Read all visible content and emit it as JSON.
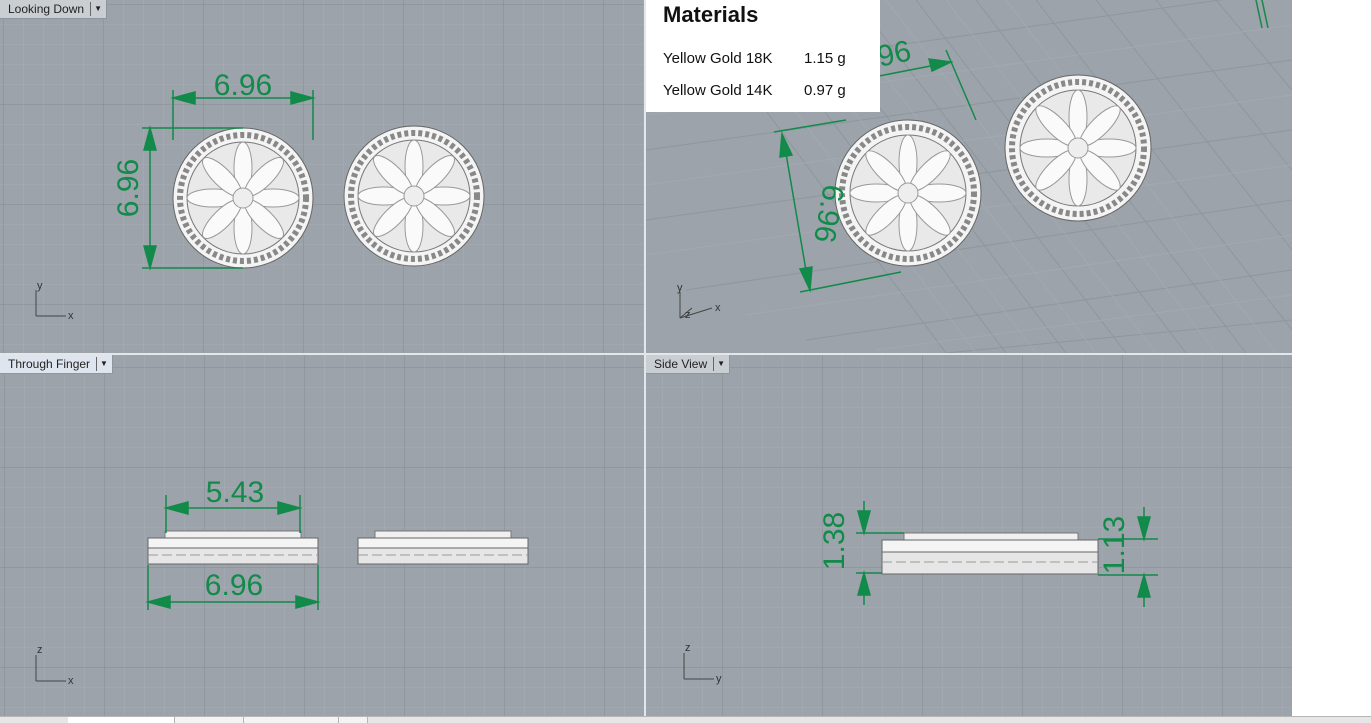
{
  "viewports": {
    "top": {
      "label": "Looking Down",
      "axis_v": "y",
      "axis_h": "x"
    },
    "perspective": {
      "axis_v": "y",
      "axis_h": "x",
      "axis_d": "z"
    },
    "front": {
      "label": "Through Finger",
      "axis_v": "z",
      "axis_h": "x"
    },
    "side": {
      "label": "Side View",
      "axis_v": "z",
      "axis_h": "y"
    }
  },
  "dimensions": {
    "top_width": "6.96",
    "top_height": "6.96",
    "persp_width": "6.96",
    "persp_height": "6.96",
    "front_top_width": "5.43",
    "front_bottom_width": "6.96",
    "side_height_left": "1.38",
    "side_height_right": "1.13"
  },
  "materials": {
    "title": "Materials",
    "items": [
      {
        "name": "Yellow Gold 18K",
        "weight": "1.15 g"
      },
      {
        "name": "Yellow Gold 14K",
        "weight": "0.97 g"
      }
    ]
  },
  "colors": {
    "viewport_bg": "#9ca3aa",
    "grid_minor": "#a9b0b6",
    "grid_major": "#7e868d",
    "dimension": "#118a4a",
    "model": "#f2f2f2"
  }
}
